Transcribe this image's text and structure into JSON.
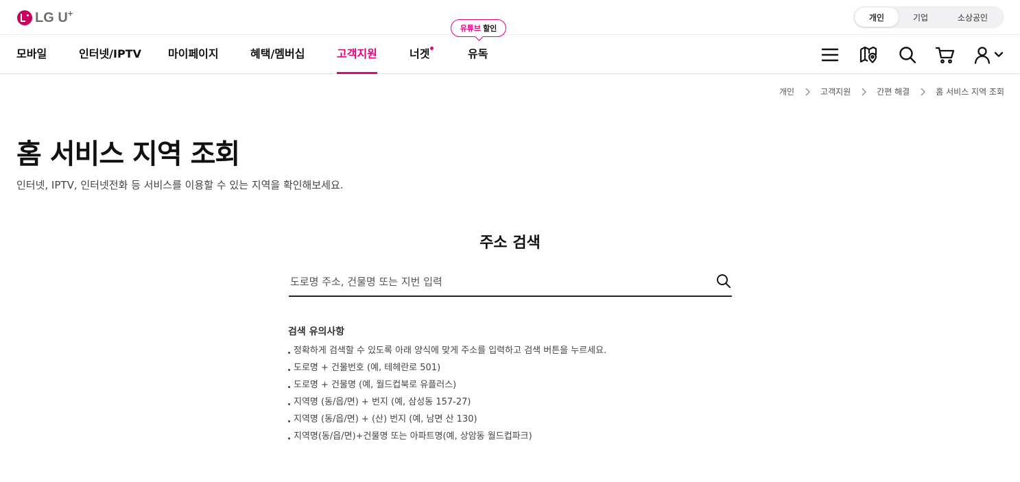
{
  "brand": {
    "logo_text": "LG U",
    "logo_sup": "+"
  },
  "segments": [
    {
      "label": "개인",
      "active": true
    },
    {
      "label": "기업",
      "active": false
    },
    {
      "label": "소상공인",
      "active": false
    }
  ],
  "nav": {
    "items": [
      {
        "label": "모바일"
      },
      {
        "label": "인터넷/IPTV"
      },
      {
        "label": "마이페이지"
      },
      {
        "label": "혜택/멤버십"
      },
      {
        "label": "고객지원",
        "active": true
      },
      {
        "label": "너겟",
        "has_dot": true
      },
      {
        "label": "유독"
      }
    ],
    "promo": {
      "highlight": "유튜브",
      "text": "할인"
    },
    "icons": [
      "menu-icon",
      "store-map-icon",
      "search-icon",
      "cart-icon",
      "user-icon"
    ],
    "accent_color": "#e6007e"
  },
  "breadcrumb": [
    "개인",
    "고객지원",
    "간편 해결",
    "홈 서비스 지역 조회"
  ],
  "page": {
    "title": "홈 서비스 지역 조회",
    "description": "인터넷, IPTV, 인터넷전화 등 서비스를 이용할 수 있는 지역을 확인해보세요."
  },
  "address_search": {
    "title": "주소 검색",
    "input_value": "",
    "placeholder": "도로명 주소, 건물명 또는 지번 입력"
  },
  "notes": {
    "title": "검색 유의사항",
    "items": [
      "정확하게 검색할 수 있도록 아래 양식에 맞게 주소를 입력하고 검색 버튼을 누르세요.",
      "도로명 + 건물번호 (예, 테헤란로 501)",
      "도로명 + 건물명 (예, 월드컵북로 유플러스)",
      "지역명 (동/읍/면) + 번지 (예, 삼성동 157-27)",
      "지역명 (동/읍/면) + (산) 번지 (예, 남면 산 130)",
      "지역명(동/읍/면)+건물명 또는 아파트명(예, 상암동 월드컵파크)"
    ]
  }
}
